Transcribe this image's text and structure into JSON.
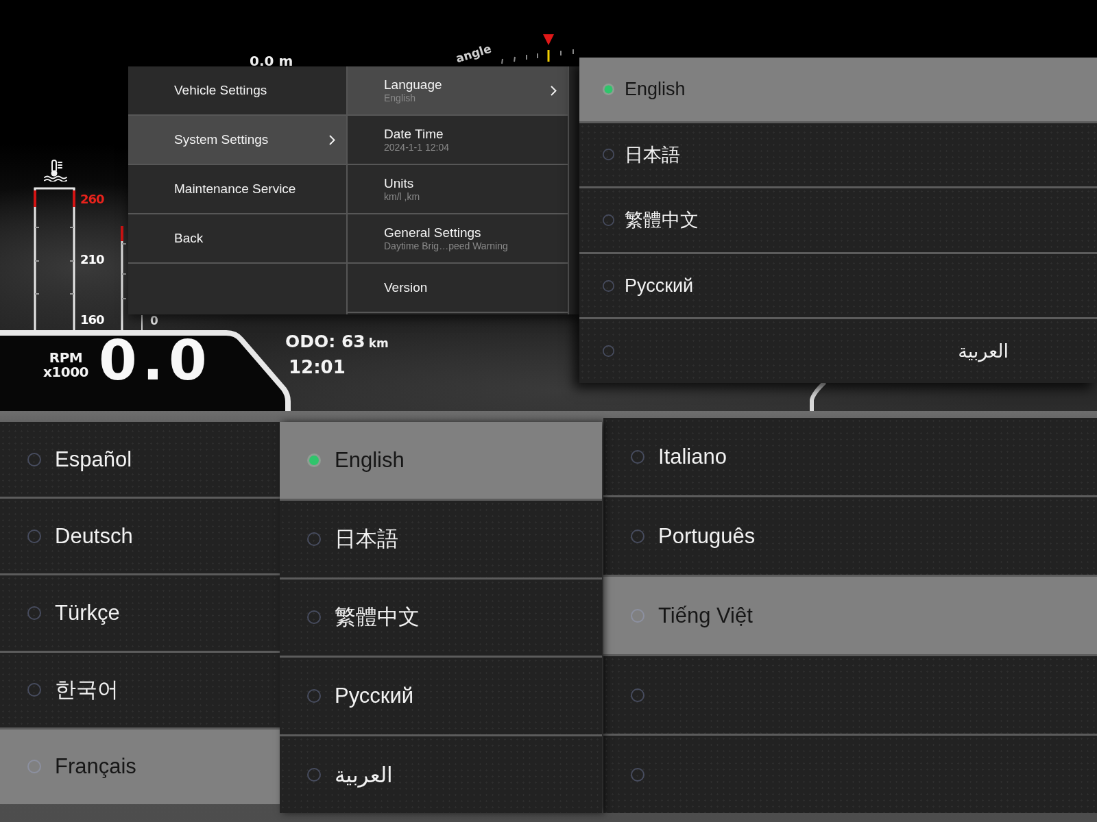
{
  "dashboard": {
    "trip_distance": "0.0 m",
    "angle_label": "angle",
    "temperature_scale": [
      {
        "label": "260",
        "color": "#e8231c"
      },
      {
        "label": "210",
        "color": "#ffffff"
      },
      {
        "label": "160",
        "color": "#ffffff"
      }
    ],
    "bar_gauge_label": "0",
    "rpm_label": "RPM",
    "rpm_unit": "x1000",
    "rpm_value": "0.0",
    "odometer": "ODO: 63",
    "odometer_unit": "km",
    "clock": "12:01"
  },
  "settings_menu": {
    "items": [
      {
        "label": "Vehicle Settings",
        "selected": false,
        "has_submenu": false
      },
      {
        "label": "System Settings",
        "selected": true,
        "has_submenu": true
      },
      {
        "label": "Maintenance Service",
        "selected": false,
        "has_submenu": false
      },
      {
        "label": "Back",
        "selected": false,
        "has_submenu": false
      }
    ]
  },
  "system_settings": {
    "items": [
      {
        "label": "Language",
        "value": "English",
        "selected": true,
        "has_submenu": true
      },
      {
        "label": "Date Time",
        "value": "2024-1-1 12:04",
        "selected": false,
        "has_submenu": false
      },
      {
        "label": "Units",
        "value": "km/l ,km",
        "selected": false,
        "has_submenu": false
      },
      {
        "label": "General Settings",
        "value": "Daytime Brig…peed Warning",
        "selected": false,
        "has_submenu": false
      },
      {
        "label": "Version",
        "selected": false,
        "has_submenu": false
      }
    ]
  },
  "language_list": {
    "items": [
      {
        "label": "English",
        "selected": true,
        "focused": true
      },
      {
        "label": "日本語",
        "selected": false,
        "focused": false
      },
      {
        "label": "繁體中文",
        "selected": false,
        "focused": false
      },
      {
        "label": "Русский",
        "selected": false,
        "focused": false
      },
      {
        "label": "العربية",
        "selected": false,
        "focused": false
      }
    ]
  },
  "language_screens": [
    {
      "items": [
        {
          "label": "Español",
          "selected": false,
          "focused": false
        },
        {
          "label": "Deutsch",
          "selected": false,
          "focused": false
        },
        {
          "label": "Türkçe",
          "selected": false,
          "focused": false
        },
        {
          "label": "한국어",
          "selected": false,
          "focused": false
        },
        {
          "label": "Français",
          "selected": false,
          "focused": true
        }
      ]
    },
    {
      "items": [
        {
          "label": "English",
          "selected": true,
          "focused": true
        },
        {
          "label": "日本語",
          "selected": false,
          "focused": false
        },
        {
          "label": "繁體中文",
          "selected": false,
          "focused": false
        },
        {
          "label": "Русский",
          "selected": false,
          "focused": false
        },
        {
          "label": "العربية",
          "selected": false,
          "focused": false
        }
      ]
    },
    {
      "items": [
        {
          "label": "Italiano",
          "selected": false,
          "focused": false
        },
        {
          "label": "Português",
          "selected": false,
          "focused": false
        },
        {
          "label": "Tiếng Việt",
          "selected": false,
          "focused": true
        },
        {
          "selected": false,
          "focused": false
        },
        {
          "selected": false,
          "focused": false
        }
      ]
    }
  ]
}
